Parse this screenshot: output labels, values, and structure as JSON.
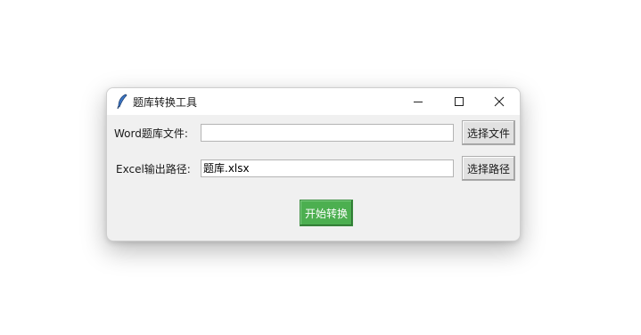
{
  "window": {
    "title": "题库转换工具",
    "controls": {
      "minimize": "minimize-icon",
      "maximize": "maximize-icon",
      "close": "close-icon"
    }
  },
  "form": {
    "word_label": "Word题库文件:",
    "word_value": "",
    "word_button": "选择文件",
    "excel_label": "Excel输出路径:",
    "excel_value": "题库.xlsx",
    "excel_button": "选择路径",
    "start_button": "开始转换"
  },
  "colors": {
    "start_button_bg": "#4caf50",
    "start_button_text": "#ffffff",
    "window_bg": "#f0f0f0"
  }
}
